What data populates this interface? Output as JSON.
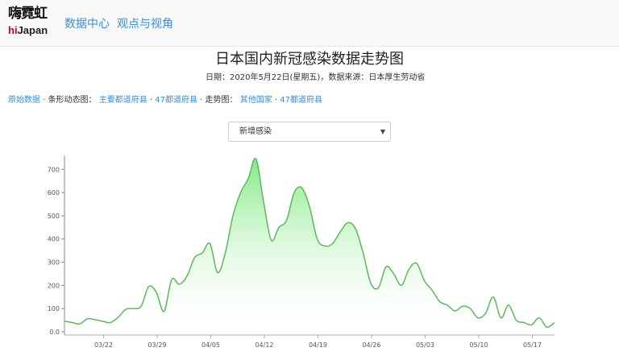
{
  "brand": {
    "kanji": "嗨霓虹",
    "latin_prefix": "hi",
    "latin_suffix": "Japan"
  },
  "nav": {
    "items": [
      {
        "label": "数据中心"
      },
      {
        "label": "观点与视角"
      }
    ]
  },
  "page": {
    "title": "日本国内新冠感染数据走势图",
    "subtitle": "日期：2020年5月22日(星期五)，数据来源：日本厚生劳动省"
  },
  "links": {
    "raw_data": "原始数据",
    "sep1": " · 条形动态图： ",
    "major_prefectures": "主要都道府县",
    "dot1": " · ",
    "prefectures_47_a": "47都道府县",
    "sep2": " · 走势图： ",
    "other_countries": "其他国家",
    "dot2": " · ",
    "prefectures_47_b": "47都道府县"
  },
  "metric_select": {
    "selected": "新增感染"
  },
  "colors": {
    "accent": "#3a8ed1",
    "line": "#5cb85c",
    "fill_top": "#7de87d"
  },
  "chart_data": {
    "type": "area",
    "title": "",
    "xlabel": "",
    "ylabel": "",
    "ylim": [
      0,
      760
    ],
    "y_ticks": [
      0,
      100,
      200,
      300,
      400,
      500,
      600,
      700
    ],
    "y_tick_labels": [
      "0.0",
      "100",
      "200",
      "300",
      "400",
      "500",
      "600",
      "700"
    ],
    "x_ticks": [
      "03/22",
      "03/29",
      "04/05",
      "04/12",
      "04/19",
      "04/26",
      "05/03",
      "05/10",
      "05/17"
    ],
    "x_start": "03/17",
    "values": [
      45,
      40,
      34,
      56,
      52,
      45,
      40,
      62,
      97,
      100,
      110,
      195,
      170,
      88,
      225,
      205,
      240,
      320,
      340,
      380,
      255,
      340,
      500,
      600,
      660,
      745,
      560,
      395,
      450,
      480,
      600,
      620,
      540,
      400,
      370,
      380,
      430,
      470,
      445,
      340,
      210,
      190,
      280,
      250,
      200,
      270,
      295,
      220,
      180,
      130,
      115,
      90,
      110,
      100,
      60,
      80,
      150,
      60,
      115,
      50,
      40,
      30,
      60,
      20,
      40
    ]
  }
}
